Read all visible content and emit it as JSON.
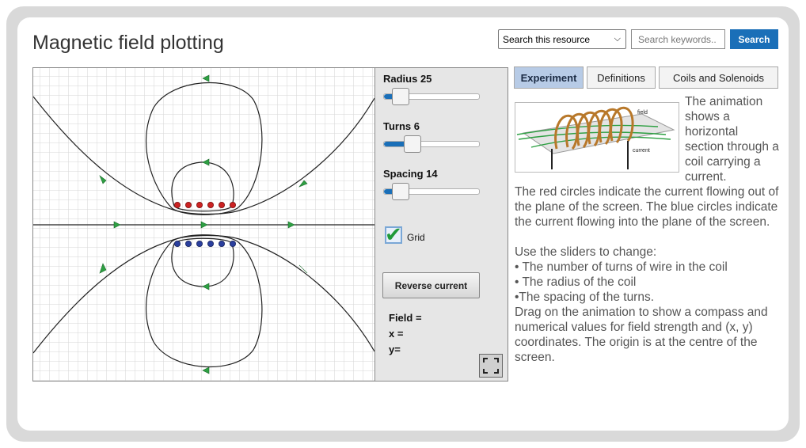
{
  "header": {
    "title": "Magnetic field plotting",
    "scope_select": {
      "selected": "Search this resource"
    },
    "search": {
      "placeholder": "Search keywords..",
      "button_label": "Search"
    }
  },
  "controls": {
    "radius": {
      "label": "Radius 25",
      "level": 0.17
    },
    "turns": {
      "label": "Turns 6",
      "level": 0.29
    },
    "spacing": {
      "label": "Spacing 14",
      "level": 0.17
    },
    "grid": {
      "label": "Grid",
      "checked": true
    },
    "reverse_button": "Reverse current",
    "readout": {
      "field": "Field =",
      "x": "x =",
      "y": "y="
    },
    "fullscreen_icon": "fullscreen-icon"
  },
  "simulation": {
    "current_out_color": "#cc2222",
    "current_in_color": "#2a3f9e",
    "arrow_color": "#2ea043",
    "turns": 6,
    "grid": true
  },
  "info_panel": {
    "tabs": [
      {
        "label": "Experiment",
        "active": true
      },
      {
        "label": "Definitions",
        "active": false
      },
      {
        "label": "Coils and Solenoids",
        "active": false
      }
    ],
    "image_labels": {
      "field": "field",
      "current": "current"
    },
    "paragraphs": {
      "intro": "The animation shows a horizontal section through a coil carrying a current.",
      "circles": "The red circles indicate the current flowing out of the plane of the screen. The blue circles indicate the current flowing into the plane of the screen.",
      "sliders_intro": "Use the sliders to change:",
      "bullet_turns": "• The number of turns of wire in the coil",
      "bullet_radius": "• The radius of the coil",
      "bullet_spacing": "•The spacing of the turns.",
      "drag": "Drag on the animation to show a compass and numerical values for field strength and (x, y) coordinates. The origin is at the centre of the screen."
    }
  },
  "colors": {
    "accent": "#1a6fb8",
    "active_tab": "#b7cbe6",
    "panel_bg": "#e6e6e6",
    "frame": "#d9d9d9"
  }
}
